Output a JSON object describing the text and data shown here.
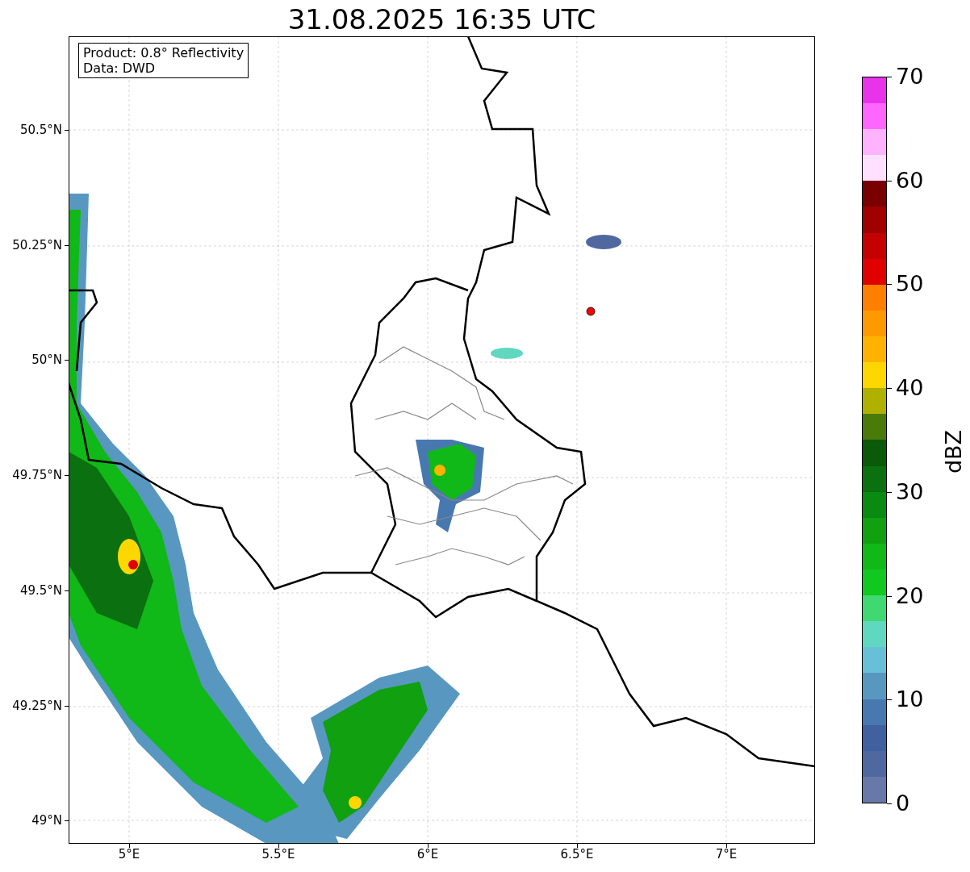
{
  "title": "31.08.2025 16:35 UTC",
  "info_box": {
    "lines": [
      "Product: 0.8° Reflectivity",
      "Data: DWD"
    ]
  },
  "map": {
    "y_ticks": [
      "50.5°N",
      "50.25°N",
      "50°N",
      "49.75°N",
      "49.5°N",
      "49.25°N",
      "49°N"
    ],
    "x_ticks": [
      "5°E",
      "5.5°E",
      "6°E",
      "6.5°E",
      "7°E"
    ]
  },
  "colorbar": {
    "label": "dBZ",
    "ticks": [
      "70",
      "60",
      "50",
      "40",
      "30",
      "20",
      "10",
      "0"
    ],
    "bands": [
      {
        "color": "#6878a8"
      },
      {
        "color": "#5068a0"
      },
      {
        "color": "#4060a0"
      },
      {
        "color": "#4878b0"
      },
      {
        "color": "#5898c0"
      },
      {
        "color": "#68c0d8"
      },
      {
        "color": "#60d8c0"
      },
      {
        "color": "#40d870"
      },
      {
        "color": "#10c820"
      },
      {
        "color": "#10b818"
      },
      {
        "color": "#10a010"
      },
      {
        "color": "#0a8a10"
      },
      {
        "color": "#0a7010"
      },
      {
        "color": "#0a5a0a"
      },
      {
        "color": "#4a7a0a"
      },
      {
        "color": "#b0b000"
      },
      {
        "color": "#ffd700"
      },
      {
        "color": "#ffb300"
      },
      {
        "color": "#ff9900"
      },
      {
        "color": "#ff7f00"
      },
      {
        "color": "#e00000"
      },
      {
        "color": "#c40000"
      },
      {
        "color": "#a00000"
      },
      {
        "color": "#7a0000"
      },
      {
        "color": "#ffe0ff"
      },
      {
        "color": "#ffb3ff"
      },
      {
        "color": "#ff66ff"
      },
      {
        "color": "#e833ea"
      }
    ]
  }
}
